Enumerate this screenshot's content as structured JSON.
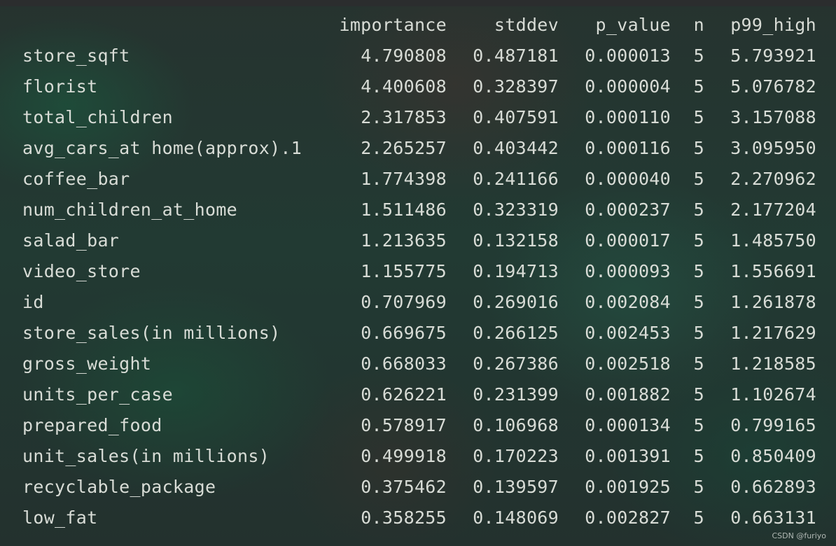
{
  "table": {
    "headers": {
      "importance": "importance",
      "stddev": "stddev",
      "p_value": "p_value",
      "n": "n",
      "p99_high": "p99_high"
    },
    "rows": [
      {
        "feature": "store_sqft",
        "importance": "4.790808",
        "stddev": "0.487181",
        "p_value": "0.000013",
        "n": "5",
        "p99_high": "5.793921"
      },
      {
        "feature": "florist",
        "importance": "4.400608",
        "stddev": "0.328397",
        "p_value": "0.000004",
        "n": "5",
        "p99_high": "5.076782"
      },
      {
        "feature": "total_children",
        "importance": "2.317853",
        "stddev": "0.407591",
        "p_value": "0.000110",
        "n": "5",
        "p99_high": "3.157088"
      },
      {
        "feature": "avg_cars_at home(approx).1",
        "importance": "2.265257",
        "stddev": "0.403442",
        "p_value": "0.000116",
        "n": "5",
        "p99_high": "3.095950"
      },
      {
        "feature": "coffee_bar",
        "importance": "1.774398",
        "stddev": "0.241166",
        "p_value": "0.000040",
        "n": "5",
        "p99_high": "2.270962"
      },
      {
        "feature": "num_children_at_home",
        "importance": "1.511486",
        "stddev": "0.323319",
        "p_value": "0.000237",
        "n": "5",
        "p99_high": "2.177204"
      },
      {
        "feature": "salad_bar",
        "importance": "1.213635",
        "stddev": "0.132158",
        "p_value": "0.000017",
        "n": "5",
        "p99_high": "1.485750"
      },
      {
        "feature": "video_store",
        "importance": "1.155775",
        "stddev": "0.194713",
        "p_value": "0.000093",
        "n": "5",
        "p99_high": "1.556691"
      },
      {
        "feature": "id",
        "importance": "0.707969",
        "stddev": "0.269016",
        "p_value": "0.002084",
        "n": "5",
        "p99_high": "1.261878"
      },
      {
        "feature": "store_sales(in millions)",
        "importance": "0.669675",
        "stddev": "0.266125",
        "p_value": "0.002453",
        "n": "5",
        "p99_high": "1.217629"
      },
      {
        "feature": "gross_weight",
        "importance": "0.668033",
        "stddev": "0.267386",
        "p_value": "0.002518",
        "n": "5",
        "p99_high": "1.218585"
      },
      {
        "feature": "units_per_case",
        "importance": "0.626221",
        "stddev": "0.231399",
        "p_value": "0.001882",
        "n": "5",
        "p99_high": "1.102674"
      },
      {
        "feature": "prepared_food",
        "importance": "0.578917",
        "stddev": "0.106968",
        "p_value": "0.000134",
        "n": "5",
        "p99_high": "0.799165"
      },
      {
        "feature": "unit_sales(in millions)",
        "importance": "0.499918",
        "stddev": "0.170223",
        "p_value": "0.001391",
        "n": "5",
        "p99_high": "0.850409"
      },
      {
        "feature": "recyclable_package",
        "importance": "0.375462",
        "stddev": "0.139597",
        "p_value": "0.001925",
        "n": "5",
        "p99_high": "0.662893"
      },
      {
        "feature": "low_fat",
        "importance": "0.358255",
        "stddev": "0.148069",
        "p_value": "0.002827",
        "n": "5",
        "p99_high": "0.663131"
      }
    ]
  },
  "watermark": "CSDN @furiyo",
  "colors": {
    "text": "#d8dcd6",
    "background": "#24302d"
  }
}
